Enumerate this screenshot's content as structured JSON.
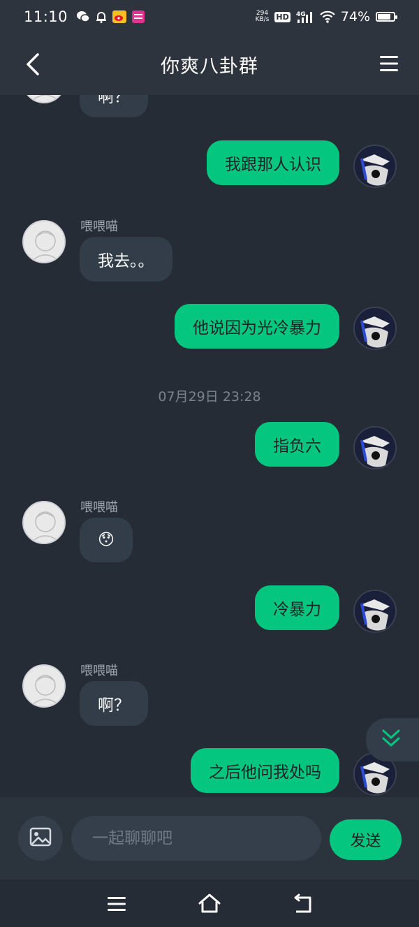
{
  "status_bar": {
    "time": "11:10",
    "net_speed_value": "294",
    "net_speed_unit": "KB/s",
    "hd": "HD",
    "network": "4G",
    "battery": "74%",
    "battery_level": 0.74
  },
  "header": {
    "title": "你爽八卦群"
  },
  "messages": [
    {
      "side": "left",
      "sender": "",
      "text": "啊？"
    },
    {
      "side": "right",
      "text": "我跟那人认识"
    },
    {
      "side": "left",
      "sender": "喂喂喵",
      "text": "我去。。"
    },
    {
      "side": "right",
      "text": "他说因为光冷暴力"
    },
    {
      "side": "right",
      "text": "指负六"
    },
    {
      "side": "left",
      "sender": "喂喂喵",
      "text": "😯"
    },
    {
      "side": "right",
      "text": "冷暴力"
    },
    {
      "side": "left",
      "sender": "喂喂喵",
      "text": "啊？"
    },
    {
      "side": "right",
      "text": "之后他问我处吗"
    }
  ],
  "timestamp": "07月29日 23:28",
  "input": {
    "placeholder": "一起聊聊吧",
    "value": "",
    "send_label": "发送"
  },
  "colors": {
    "accent": "#05c67f",
    "background": "#252c35",
    "bubble_left": "#333d49"
  },
  "icons": [
    "back-arrow-icon",
    "menu-icon",
    "image-icon",
    "scroll-down-icon",
    "nav-menu-icon",
    "nav-home-icon",
    "nav-back-icon"
  ]
}
